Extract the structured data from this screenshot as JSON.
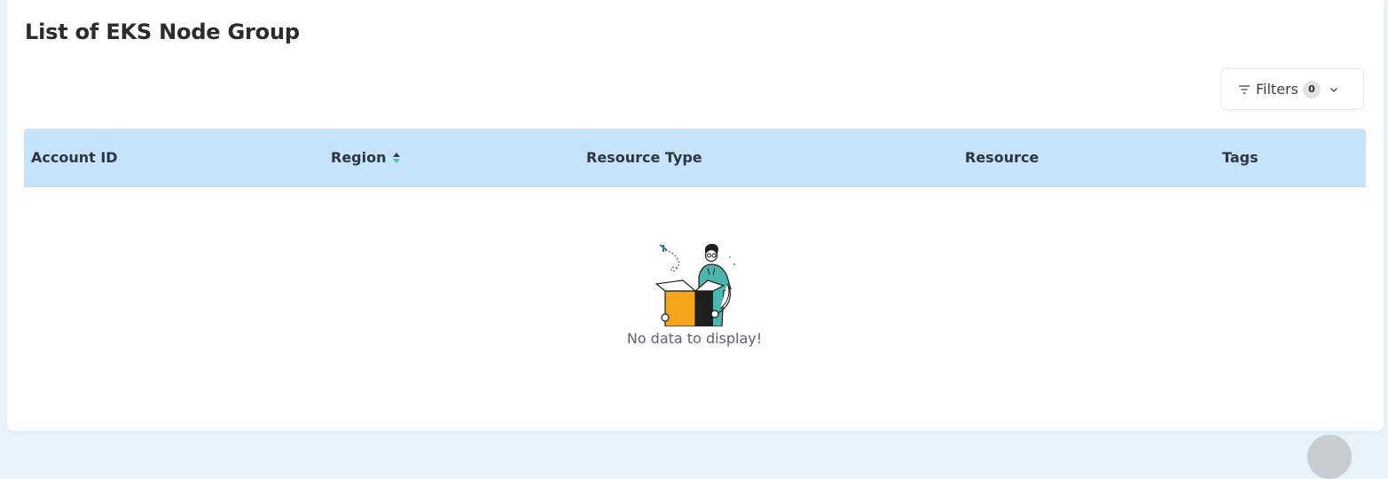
{
  "page": {
    "title": "List of EKS Node Group"
  },
  "filters": {
    "label": "Filters",
    "count": "0",
    "icon": "filter-icon"
  },
  "table": {
    "columns": [
      {
        "label": "Account ID"
      },
      {
        "label": "Region",
        "sortable": true
      },
      {
        "label": "Resource Type"
      },
      {
        "label": "Resource"
      },
      {
        "label": "Tags"
      }
    ],
    "rows": []
  },
  "empty_state": {
    "message": "No data to display!",
    "illustration": "person-with-box-illustration"
  },
  "colors": {
    "header_bg": "#c5e3fa",
    "accent_teal": "#4db6ac",
    "box_orange": "#f5a51c",
    "sort_active": "#48c4b0"
  }
}
